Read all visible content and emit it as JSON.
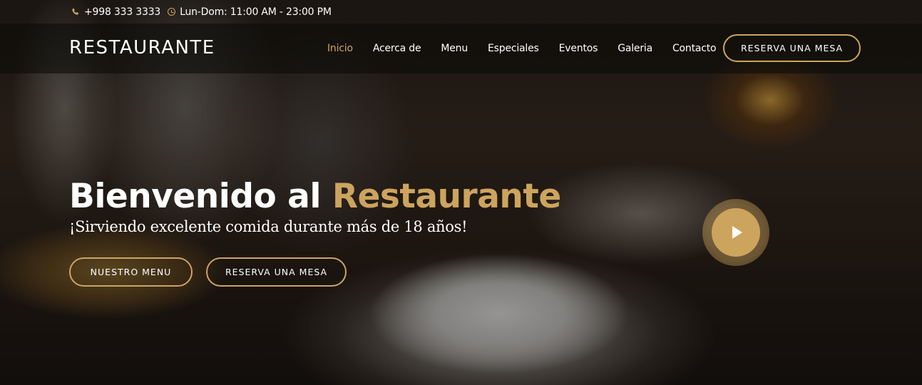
{
  "topbar": {
    "phone": "+998 333 3333",
    "hours": "Lun-Dom: 11:00 AM - 23:00 PM",
    "phone_icon": "phone-icon",
    "clock_icon": "clock-icon"
  },
  "header": {
    "logo": "RESTAURANTE",
    "nav": [
      {
        "label": "Inicio",
        "active": true
      },
      {
        "label": "Acerca de",
        "active": false
      },
      {
        "label": "Menu",
        "active": false
      },
      {
        "label": "Especiales",
        "active": false
      },
      {
        "label": "Eventos",
        "active": false
      },
      {
        "label": "Galeria",
        "active": false
      },
      {
        "label": "Contacto",
        "active": false
      }
    ],
    "reserve_label": "RESERVA UNA MESA"
  },
  "hero": {
    "title_main": "Bienvenido al ",
    "title_accent": "Restaurante",
    "subtitle": "¡Sirviendo excelente comida durante más de 18 años!",
    "btn_menu": "NUESTRO MENU",
    "btn_reserve": "RESERVA UNA MESA",
    "play_icon": "play-icon"
  },
  "colors": {
    "accent": "#cda45e",
    "text": "#ffffff"
  }
}
